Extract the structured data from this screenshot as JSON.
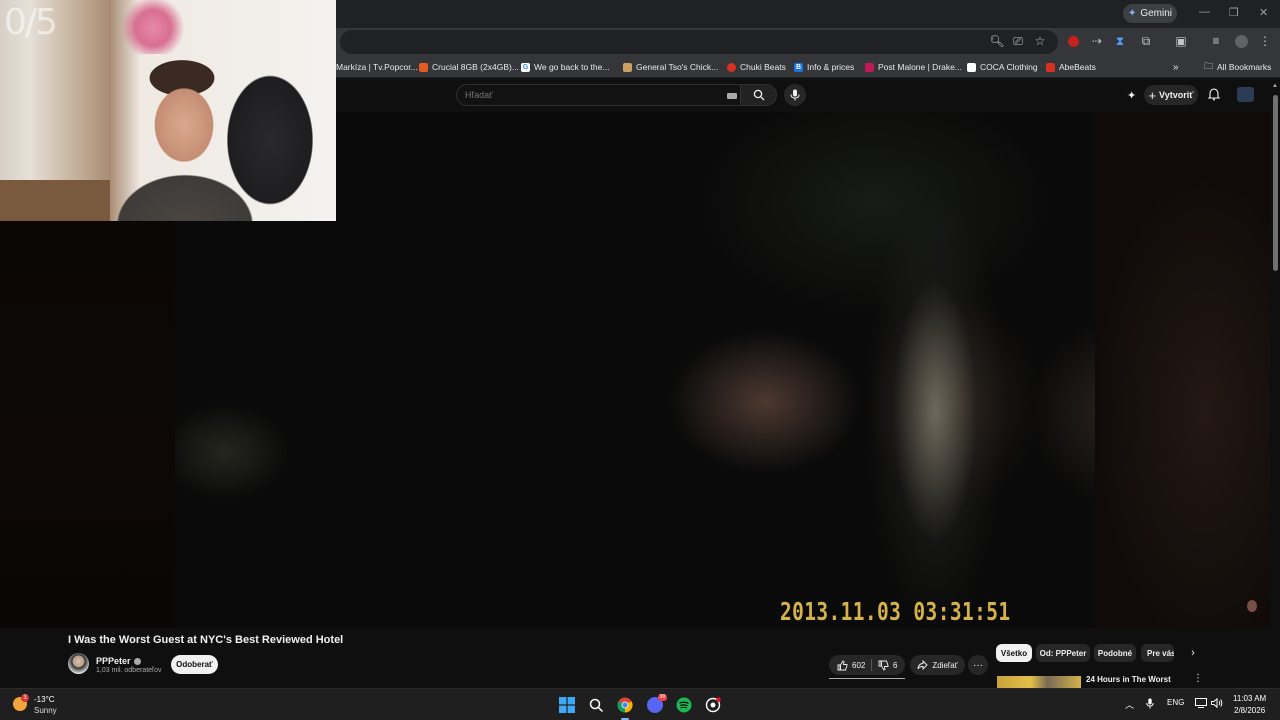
{
  "browser": {
    "gemini_label": "Gemini",
    "bookmarks": [
      {
        "label": "Markíza | Tv.Popcor...",
        "color": "#e8eaed"
      },
      {
        "label": "Crucial 8GB (2x4GB)...",
        "color": "#e55b1f"
      },
      {
        "label": "We go back to the...",
        "color": "#4285f4"
      },
      {
        "label": "General Tso's Chick...",
        "color": "#c9a061"
      },
      {
        "label": "Chuki Beats",
        "color": "#d93025"
      },
      {
        "label": "Info & prices",
        "color": "#1a73e8"
      },
      {
        "label": "Post Malone | Drake...",
        "color": "#c2185b"
      },
      {
        "label": "COCA Clothing",
        "color": "#ffffff"
      },
      {
        "label": "AbeBeats",
        "color": "#d93025"
      }
    ],
    "all_bookmarks": "All Bookmarks",
    "overflow": "»"
  },
  "youtube": {
    "search_placeholder": "Hľadať",
    "create_label": "Vytvoriť",
    "video": {
      "timestamp_overlay": "2013.11.03 03:31:51"
    },
    "webcam_counter": "0/5",
    "title": "I Was the Worst Guest at NYC's Best Reviewed Hotel",
    "channel": {
      "name": "PPPeter",
      "subscribers": "1,03 mil. odberateľov",
      "subscribe_label": "Odoberať"
    },
    "likes": "602",
    "dislikes": "6",
    "share_label": "Zdieľať",
    "more_label": "···",
    "chips": [
      "Všetko",
      "Od: PPPeter",
      "Podobné",
      "Pre vás"
    ],
    "recommendation_title": "24 Hours in The Worst"
  },
  "taskbar": {
    "temperature": "-13°C",
    "condition": "Sunny",
    "weather_badge": "3",
    "language": "ENG",
    "time": "11:03 AM",
    "date": "2/8/2026"
  },
  "colors": {
    "accent": "#8ab4f8",
    "youtube_bg": "#0f0f0f",
    "timestamp": "#d6b24a"
  }
}
